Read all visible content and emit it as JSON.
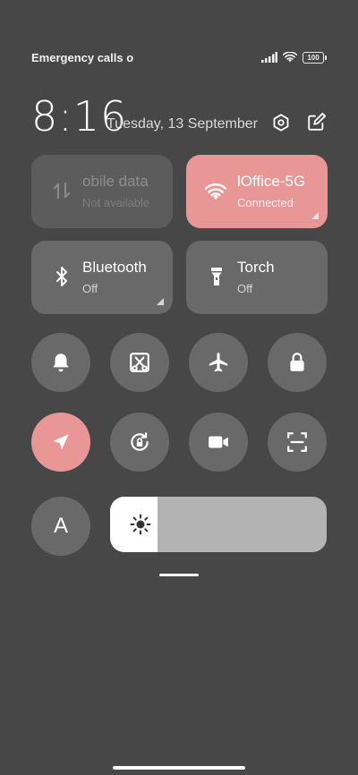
{
  "status_bar": {
    "carrier_text": "Emergency calls o",
    "battery": "100",
    "icons": [
      "signal-icon",
      "wifi-icon",
      "battery-icon"
    ]
  },
  "header": {
    "time": "8:16",
    "date": "Tuesday, 13 September",
    "icons": [
      "settings-icon",
      "edit-icon"
    ]
  },
  "tiles": {
    "mobile_data": {
      "title": "obile data",
      "subtitle": "Not available",
      "icon": "mobile-data-icon",
      "state": "unavailable"
    },
    "wifi": {
      "title": "lOffice-5G",
      "subtitle": "Connected",
      "icon": "wifi-icon",
      "state": "on"
    },
    "bluetooth": {
      "title": "Bluetooth",
      "subtitle": "Off",
      "icon": "bluetooth-icon",
      "state": "off"
    },
    "torch": {
      "title": "Torch",
      "subtitle": "Off",
      "icon": "torch-icon",
      "state": "off"
    }
  },
  "toggles": [
    {
      "name": "bell-icon",
      "state": "off"
    },
    {
      "name": "screenshot-icon",
      "state": "off"
    },
    {
      "name": "airplane-icon",
      "state": "off"
    },
    {
      "name": "lock-icon",
      "state": "off"
    },
    {
      "name": "location-icon",
      "state": "on"
    },
    {
      "name": "rotation-lock-icon",
      "state": "off"
    },
    {
      "name": "screen-record-icon",
      "state": "off"
    },
    {
      "name": "scanner-icon",
      "state": "off"
    }
  ],
  "auto_brightness": {
    "label": "A"
  },
  "brightness": {
    "level": 0.22,
    "icon": "sun-icon"
  },
  "colors": {
    "background": "#474747",
    "tile_off": "#696969",
    "tile_active": "#e89696",
    "tile_unavailable": "#5c5c5c",
    "slider_track": "#b3b3b3",
    "slider_fill": "#ffffff"
  }
}
